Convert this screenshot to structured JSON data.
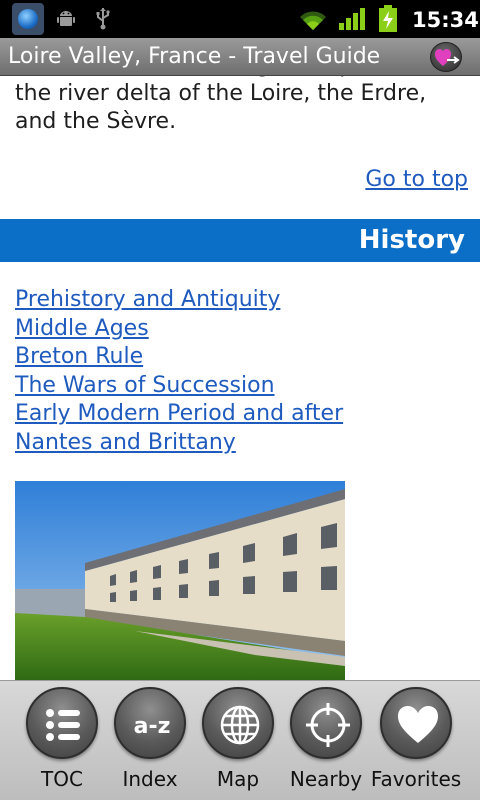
{
  "status_bar": {
    "time": "15:34",
    "icons": [
      "app-icon",
      "android-debug-icon",
      "usb-icon",
      "wifi-icon",
      "signal-icon",
      "battery-charging-icon"
    ]
  },
  "title_bar": {
    "title": "Loire Valley, France - Travel Guide",
    "favorite_icon": "heart-arrow-icon"
  },
  "content": {
    "partial_text": "l'Ouest), a name owing to its position on the river delta of the Loire, the Erdre, and the Sèvre.",
    "go_to_top": "Go to top",
    "section_title": "History",
    "links": [
      "Prehistory and Antiquity",
      "Middle Ages",
      "Breton Rule",
      "The Wars of Succession",
      "Early Modern Period and after",
      "Nantes and Brittany"
    ]
  },
  "bottom_nav": [
    {
      "label": "TOC",
      "icon": "list-icon"
    },
    {
      "label": "Index",
      "icon": "a-z-icon"
    },
    {
      "label": "Map",
      "icon": "globe-icon"
    },
    {
      "label": "Nearby",
      "icon": "target-icon"
    },
    {
      "label": "Favorites",
      "icon": "heart-icon"
    }
  ],
  "colors": {
    "section_header": "#0c6fc7",
    "link": "#1f5bbf",
    "status_bar": "#000000",
    "battery_green": "#8ccf18"
  }
}
